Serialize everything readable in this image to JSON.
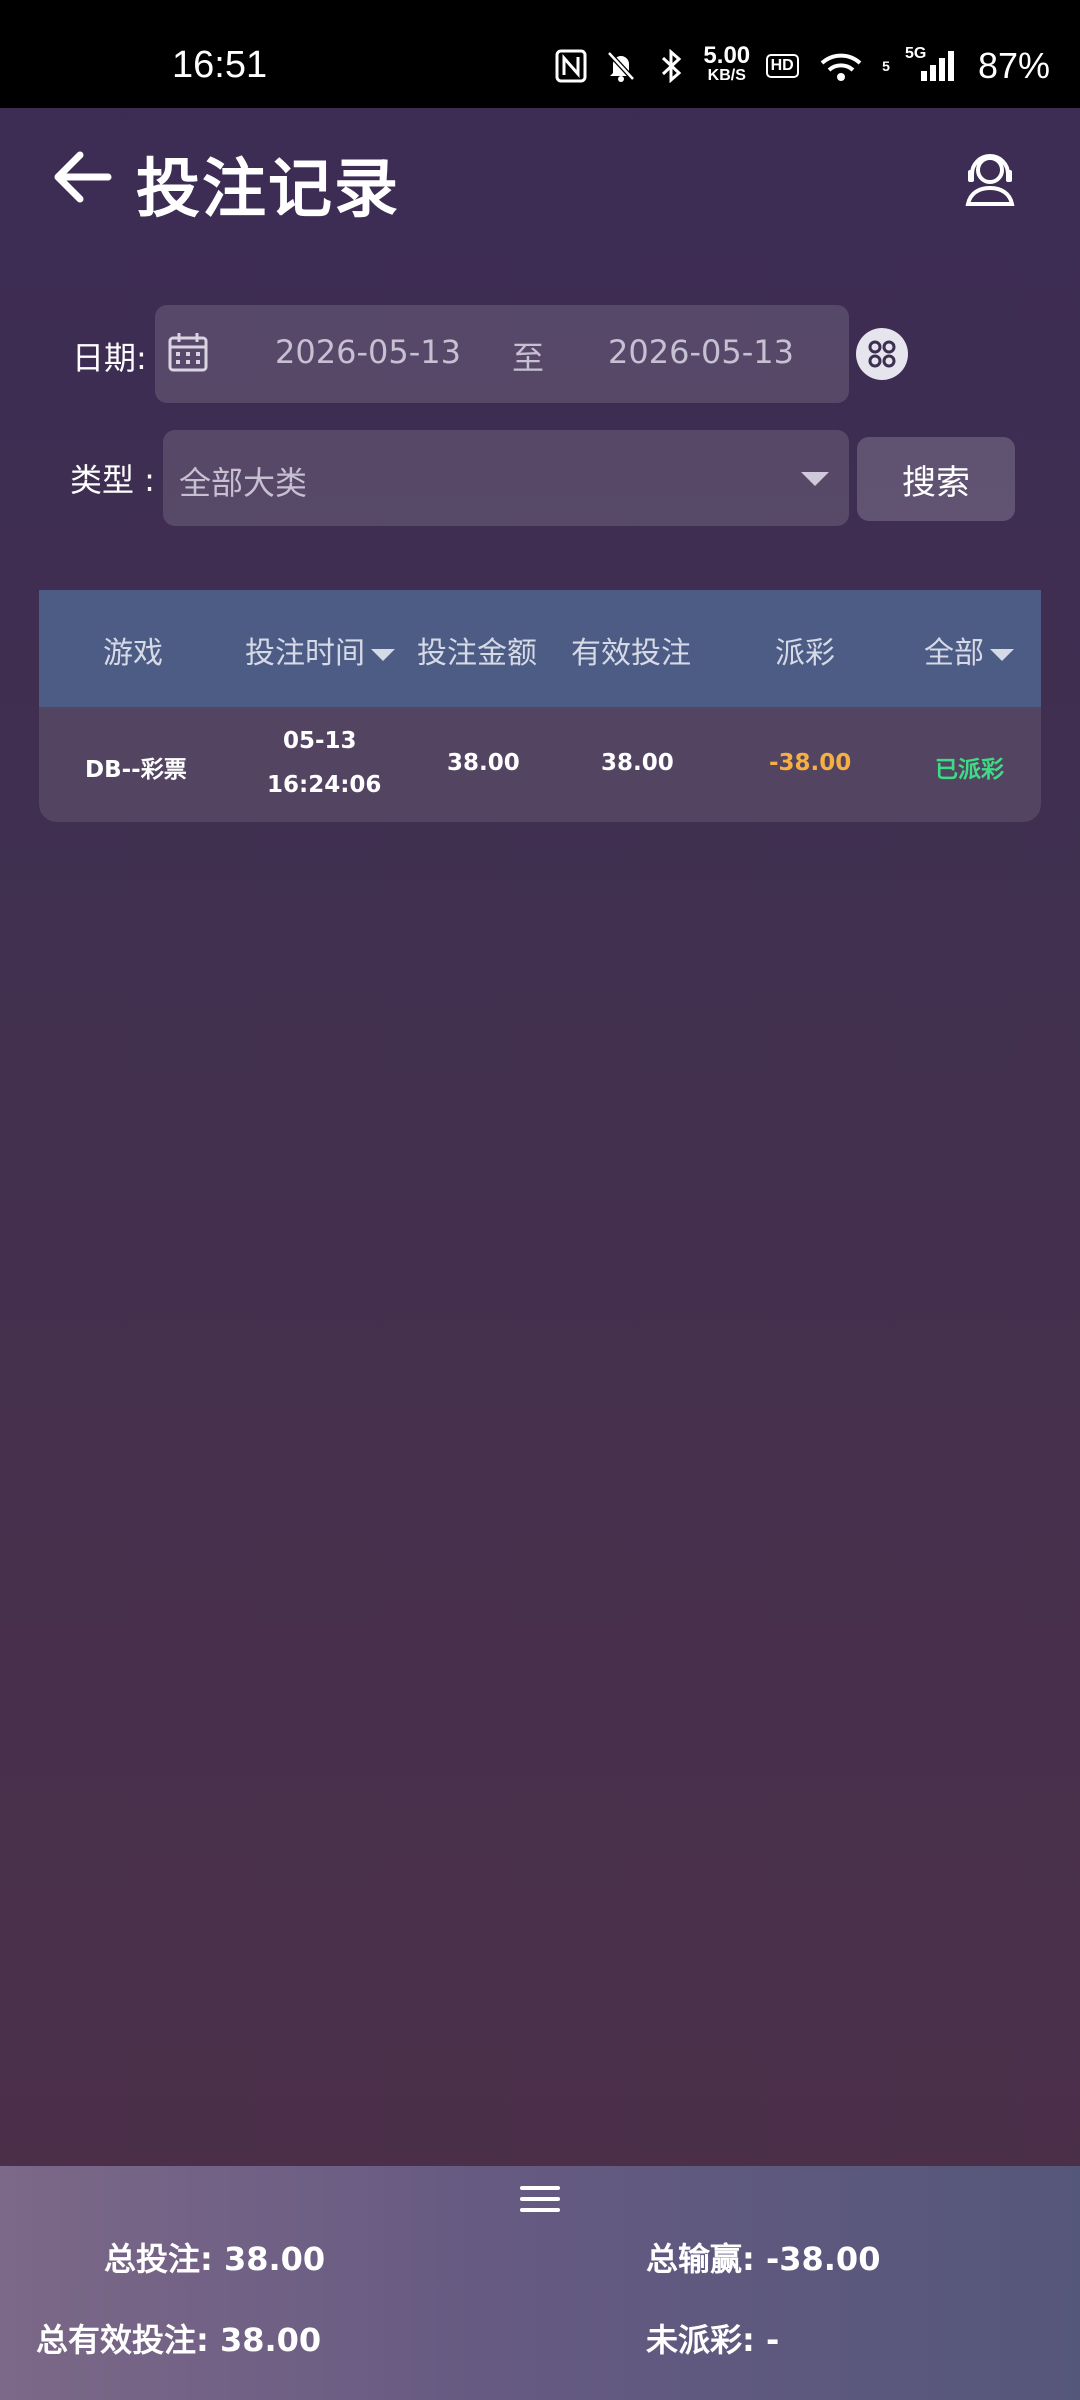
{
  "status_bar": {
    "time": "16:51",
    "net_speed_top": "5.00",
    "net_speed_bottom": "KB/S",
    "hd": "HD",
    "network": "5G",
    "wifi_sub": "5",
    "battery": "87%"
  },
  "header": {
    "title": "投注记录"
  },
  "filters": {
    "date_label": "日期:",
    "date_from": "2026-05-13",
    "date_sep": "至",
    "date_to": "2026-05-13",
    "type_label": "类型 :",
    "type_value": "全部大类",
    "search_label": "搜索"
  },
  "table": {
    "headers": [
      "游戏",
      "投注时间",
      "投注金额",
      "有效投注",
      "派彩",
      "全部"
    ],
    "rows": [
      {
        "game": "DB--彩票",
        "date": "05-13",
        "time": "16:24:06",
        "amount": "38.00",
        "valid": "38.00",
        "payout": "-38.00",
        "status": "已派彩"
      }
    ]
  },
  "summary": {
    "total_bet_label": "总投注:",
    "total_bet": "38.00",
    "total_winloss_label": "总输赢:",
    "total_winloss": "-38.00",
    "total_valid_label": "总有效投注:",
    "total_valid": "38.00",
    "unsettled_label": "未派彩:",
    "unsettled": "-"
  },
  "colors": {
    "accent_header": "#4c5c84",
    "payout": "#f5b041",
    "status": "#3ddc84"
  }
}
